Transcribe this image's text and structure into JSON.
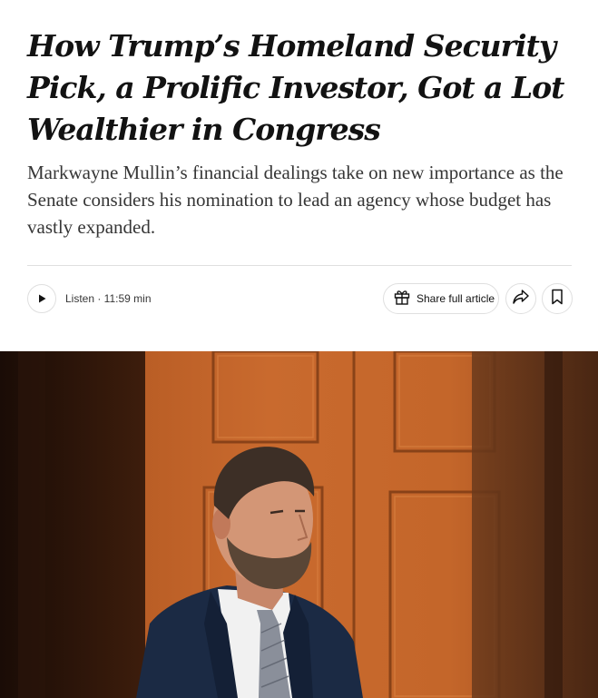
{
  "article": {
    "headline": "How Trump’s Homeland Security Pick, a Prolific Investor, Got a Lot Wealthier in Congress",
    "summary": "Markwayne Mullin’s financial dealings take on new importance as the Senate considers his nomination to lead an agency whose budget has vastly expanded."
  },
  "toolbar": {
    "listen_label": "Listen · 11:59 min",
    "share_label": "Share full article",
    "icons": {
      "play": "play-icon",
      "gift": "gift-icon",
      "share": "share-arrow-icon",
      "save": "bookmark-icon"
    }
  },
  "colors": {
    "text": "#121212",
    "summary_text": "#363636",
    "border": "#dfdfdf"
  }
}
